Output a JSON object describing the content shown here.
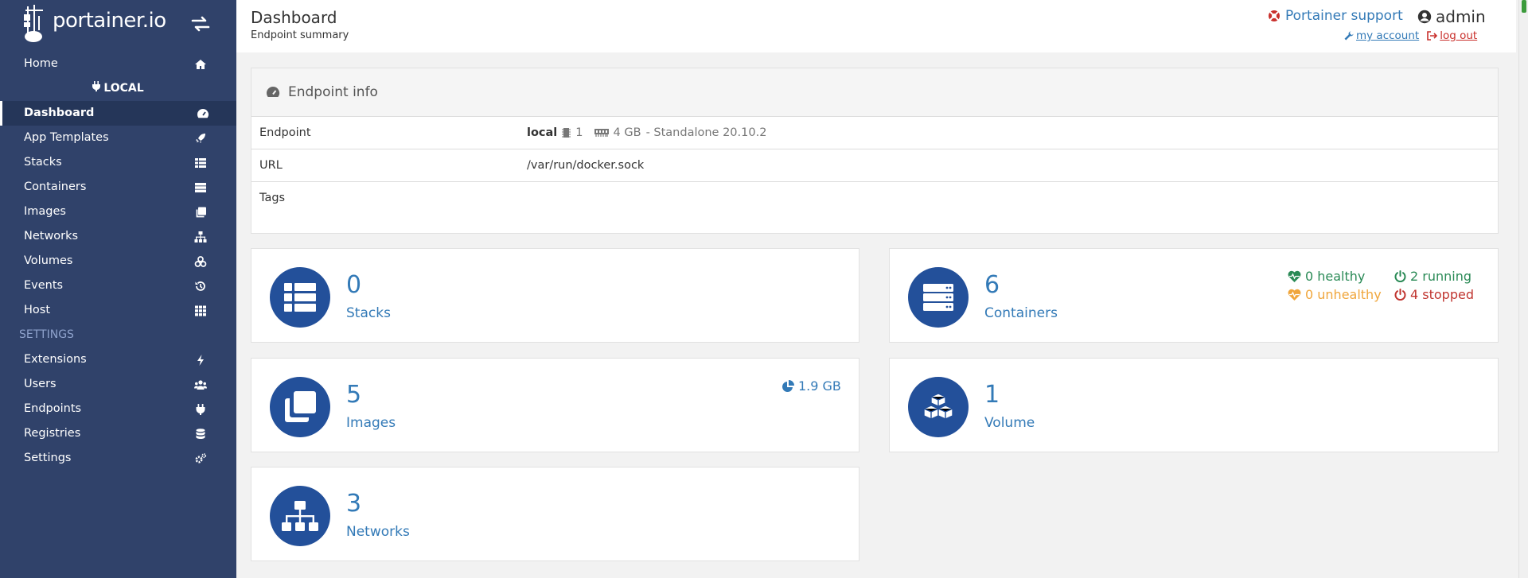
{
  "sidebar": {
    "brand": "portainer.io",
    "items": {
      "home": "Home",
      "endpoint": "LOCAL",
      "dashboard": "Dashboard",
      "app_templates": "App Templates",
      "stacks": "Stacks",
      "containers": "Containers",
      "images": "Images",
      "networks": "Networks",
      "volumes": "Volumes",
      "events": "Events",
      "host": "Host",
      "settings_heading": "SETTINGS",
      "extensions": "Extensions",
      "users": "Users",
      "endpoints": "Endpoints",
      "registries": "Registries",
      "settings": "Settings"
    },
    "colors": {
      "background": "#30426a",
      "active": "#253659",
      "heading": "#8ea2cc"
    }
  },
  "header": {
    "title": "Dashboard",
    "subtitle": "Endpoint summary",
    "support": "Portainer support",
    "user": "admin",
    "my_account": "my account",
    "log_out": "log out"
  },
  "endpoint_info": {
    "title": "Endpoint info",
    "endpoint_label": "Endpoint",
    "endpoint_name": "local",
    "cpu": "1",
    "memory": "4 GB",
    "mode": "- Standalone 20.10.2",
    "url_label": "URL",
    "url_value": "/var/run/docker.sock",
    "tags_label": "Tags"
  },
  "widgets": {
    "stacks": {
      "count": "0",
      "label": "Stacks"
    },
    "containers": {
      "count": "6",
      "label": "Containers",
      "healthy": "0 healthy",
      "unhealthy": "0 unhealthy",
      "running": "2 running",
      "stopped": "4 stopped"
    },
    "images": {
      "count": "5",
      "label": "Images",
      "size": "1.9 GB"
    },
    "volumes": {
      "count": "1",
      "label": "Volume"
    },
    "networks": {
      "count": "3",
      "label": "Networks"
    }
  },
  "icons": {
    "home": "home-icon",
    "dashboard": "tachometer-icon",
    "templates": "rocket-icon",
    "stacks": "th-list-icon",
    "containers": "server-icon",
    "images": "clone-icon",
    "networks": "sitemap-icon",
    "volumes": "cubes-icon",
    "events": "history-icon",
    "host": "th-icon",
    "extensions": "bolt-icon",
    "users": "users-icon",
    "endpoints": "plug-icon",
    "registries": "database-icon",
    "settings": "cogs-icon"
  },
  "accent": "#337ab7"
}
